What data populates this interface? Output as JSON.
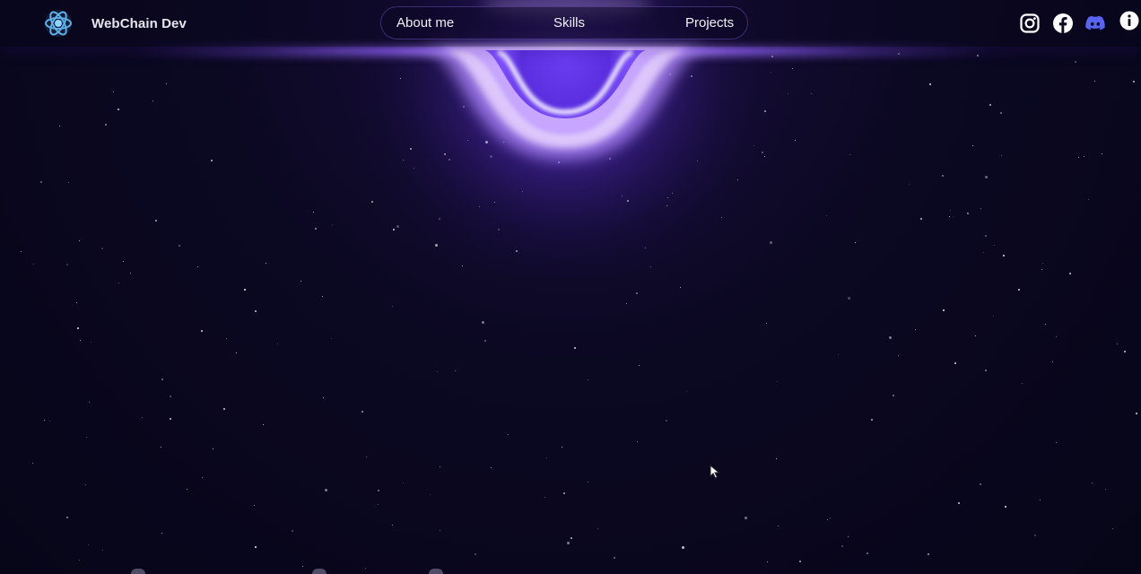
{
  "header": {
    "brand": {
      "name": "WebChain Dev",
      "logo_icon": "atom-logo-icon"
    },
    "nav": {
      "items": [
        {
          "label": "About me"
        },
        {
          "label": "Skills"
        },
        {
          "label": "Projects"
        }
      ]
    },
    "social": [
      {
        "icon": "instagram-icon"
      },
      {
        "icon": "facebook-icon"
      },
      {
        "icon": "discord-icon"
      },
      {
        "icon": "info-icon"
      }
    ]
  },
  "hero": {
    "visual": "black-hole-glow",
    "accent_color": "#7c4dff",
    "glow_color": "#e9d5ff"
  },
  "colors": {
    "background": "#07051a",
    "text": "#f0f0f6",
    "discord": "#5865f2"
  }
}
